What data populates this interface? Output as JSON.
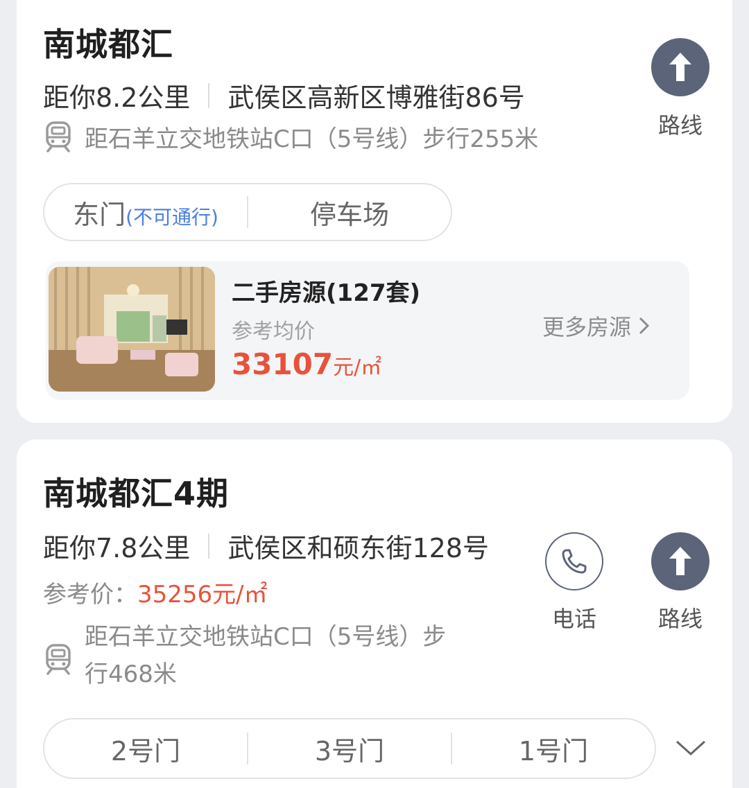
{
  "cards": [
    {
      "title": "南城都汇",
      "distance": "距你8.2公里",
      "address": "武侯区高新区博雅街86号",
      "metro": "距石羊立交地铁站C口（5号线）步行255米",
      "route_label": "路线",
      "gates": [
        {
          "label": "东门",
          "note": "(不可通行)"
        },
        {
          "label": "停车场"
        }
      ],
      "housing": {
        "title": "二手房源(127套)",
        "price_label": "参考均价",
        "price_value": "33107",
        "price_unit": "元/㎡",
        "more": "更多房源"
      }
    },
    {
      "title": "南城都汇4期",
      "distance": "距你7.8公里",
      "address": "武侯区和硕东街128号",
      "price_label": "参考价：",
      "price_value": "35256元/㎡",
      "metro_line1": "距石羊立交地铁站C口（5号线）步",
      "metro_line2": "行468米",
      "phone_label": "电话",
      "route_label": "路线",
      "gates": [
        "2号门",
        "3号门",
        "1号门"
      ]
    }
  ],
  "icons": {
    "metro": "metro-icon",
    "route": "route-arrow-icon",
    "phone": "phone-icon",
    "more": "chevron-right-icon",
    "expand": "chevron-down-icon"
  },
  "colors": {
    "accent_red": "#e8523b",
    "nav_button": "#5b6478",
    "link_blue": "#4a7ee0"
  }
}
